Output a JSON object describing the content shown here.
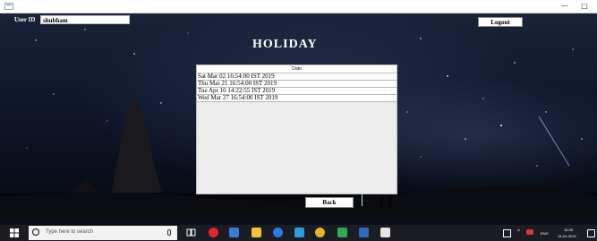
{
  "form": {
    "user_id_label": "User ID",
    "user_id_value": "shubham",
    "logout_label": "Logout",
    "title": "HOLIDAY",
    "back_label": "Back"
  },
  "date_list": {
    "header": "Date",
    "rows": [
      "Sat Mar 02 16:54:00 IST 2019",
      "Thu Mar 21 16:54:00 IST 2019",
      "Tue Apr 16 14:22:55 IST 2019",
      "Wed Mar 27 16:54:00 IST 2019"
    ]
  },
  "taskbar": {
    "search_placeholder": "Type here to search",
    "language": "ENG",
    "time": "16:39",
    "date": "14-04-2019",
    "icons": [
      "windows-start-icon",
      "cortana-icon",
      "microphone-icon",
      "task-view-icon",
      "opera-icon",
      "store-icon",
      "file-explorer-icon",
      "edge-icon",
      "paint-icon",
      "chrome-icon",
      "app-icon",
      "app-icon",
      "java-app-icon",
      "network-icon",
      "chevron-up-icon",
      "flag-icon",
      "notification-icon"
    ]
  },
  "colors": {
    "taskbar": "#1c1d22",
    "title_text": "#ffffff"
  }
}
